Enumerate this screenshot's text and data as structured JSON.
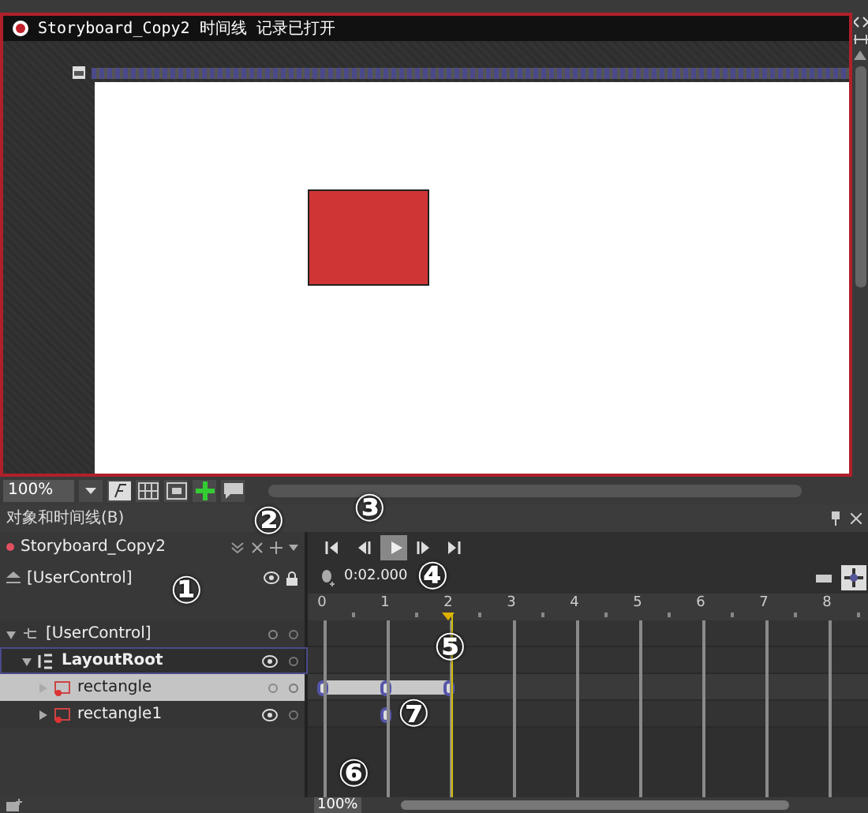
{
  "recording_banner": {
    "title": "Storyboard_Copy2 时间线 记录已打开"
  },
  "toolbar": {
    "zoom": "100%"
  },
  "panel": {
    "title": "对象和时间线(B)"
  },
  "storyboard": {
    "name": "Storyboard_Copy2"
  },
  "scope": {
    "name": "[UserControl]"
  },
  "time": "0:02.000",
  "ruler": [
    {
      "label": "0",
      "playhead": false
    },
    {
      "label": "1",
      "playhead": false
    },
    {
      "label": "2",
      "playhead": true
    },
    {
      "label": "3",
      "playhead": false
    },
    {
      "label": "4",
      "playhead": false
    },
    {
      "label": "5",
      "playhead": false
    },
    {
      "label": "6",
      "playhead": false
    },
    {
      "label": "7",
      "playhead": false
    },
    {
      "label": "8",
      "playhead": false
    }
  ],
  "tree": [
    {
      "label": "[UserControl]",
      "expanded": true,
      "selected": false,
      "active_container": false,
      "show_eye": false,
      "children": [
        {
          "label": "LayoutRoot",
          "expanded": true,
          "selected": false,
          "active_container": true,
          "show_eye": true,
          "children": [
            {
              "label": "rectangle",
              "expanded": false,
              "selected": true,
              "active_container": false,
              "show_eye": false,
              "keyframe_at_ticks": [
                true,
                true,
                true,
                false,
                false,
                false,
                false,
                false,
                false
              ]
            },
            {
              "label": "rectangle1",
              "expanded": false,
              "selected": false,
              "active_container": false,
              "show_eye": true,
              "keyframe_at_ticks": [
                false,
                true,
                false,
                false,
                false,
                false,
                false,
                false,
                false
              ]
            }
          ]
        }
      ]
    }
  ],
  "timeline_zoom": "100%",
  "annotations": [
    "①",
    "②",
    "③",
    "④",
    "⑤",
    "⑥",
    "⑦"
  ]
}
